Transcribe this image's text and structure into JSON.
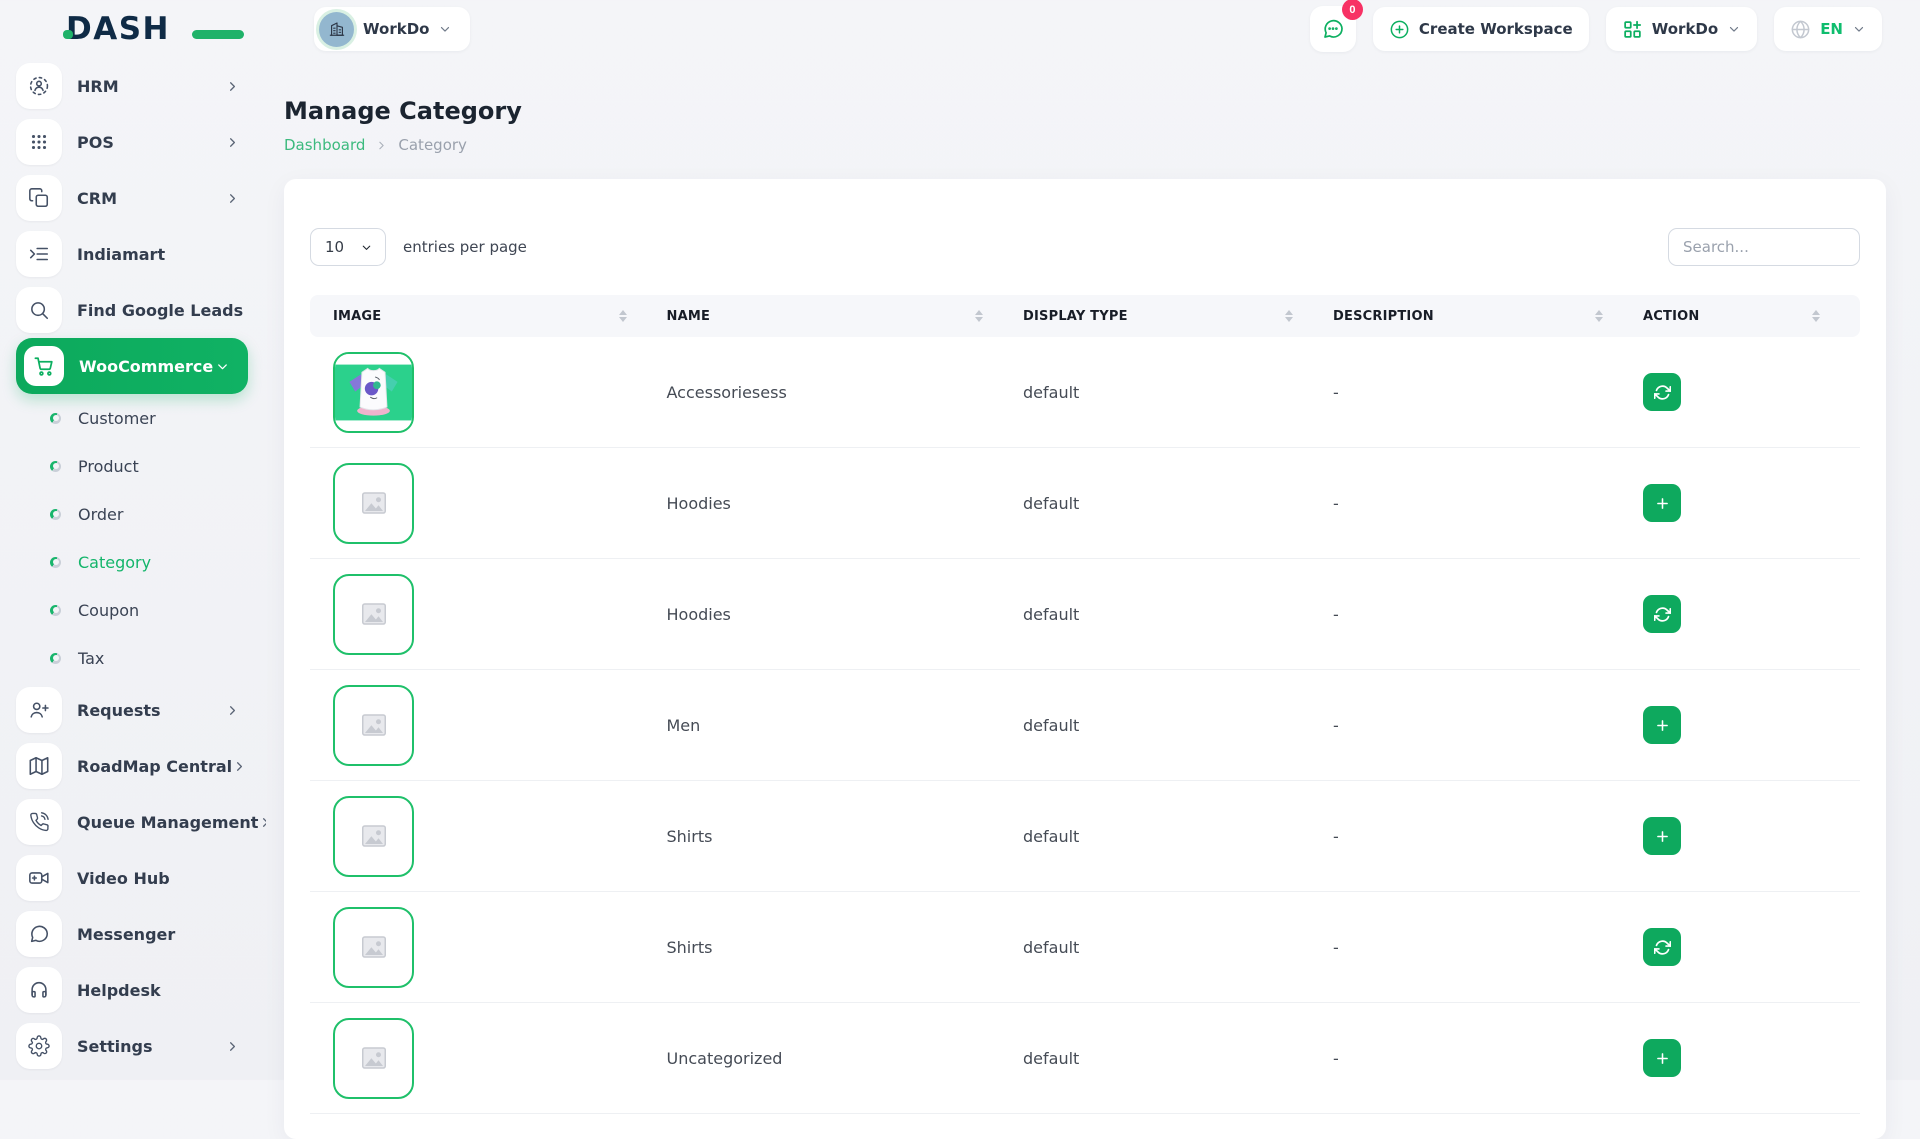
{
  "brand": {
    "logo_text": "DASH"
  },
  "header": {
    "workspace_label": "WorkDo",
    "chat_badge": "0",
    "create_workspace_label": "Create Workspace",
    "workdo_menu_label": "WorkDo",
    "language": "EN"
  },
  "sidebar": {
    "items_top": [
      {
        "label": "HRM",
        "icon": "hrm-icon",
        "chevron": true,
        "active": false
      },
      {
        "label": "POS",
        "icon": "pos-grid-icon",
        "chevron": true,
        "active": false
      },
      {
        "label": "CRM",
        "icon": "crm-icon",
        "chevron": true,
        "active": false
      },
      {
        "label": "Indiamart",
        "icon": "indiamart-icon",
        "chevron": false,
        "active": false
      },
      {
        "label": "Find Google Leads",
        "icon": "search-icon",
        "chevron": false,
        "active": false
      },
      {
        "label": "WooCommerce",
        "icon": "cart-icon",
        "chevron": "down",
        "active": true
      }
    ],
    "woocommerce_children": [
      {
        "label": "Customer",
        "active": false
      },
      {
        "label": "Product",
        "active": false
      },
      {
        "label": "Order",
        "active": false
      },
      {
        "label": "Category",
        "active": true
      },
      {
        "label": "Coupon",
        "active": false
      },
      {
        "label": "Tax",
        "active": false
      }
    ],
    "items_bottom": [
      {
        "label": "Requests",
        "icon": "user-plus-icon",
        "chevron": true
      },
      {
        "label": "RoadMap Central",
        "icon": "map-icon",
        "chevron": true
      },
      {
        "label": "Queue Management",
        "icon": "phone-call-icon",
        "chevron": true
      },
      {
        "label": "Video Hub",
        "icon": "video-icon",
        "chevron": false
      },
      {
        "label": "Messenger",
        "icon": "chat-bubble-icon",
        "chevron": false
      },
      {
        "label": "Helpdesk",
        "icon": "headset-icon",
        "chevron": false
      },
      {
        "label": "Settings",
        "icon": "gear-icon",
        "chevron": true
      }
    ]
  },
  "page": {
    "title": "Manage Category",
    "breadcrumb": [
      {
        "label": "Dashboard"
      },
      {
        "label": "Category"
      }
    ]
  },
  "table_controls": {
    "page_size": "10",
    "entries_label": "entries per page",
    "search_placeholder": "Search..."
  },
  "table": {
    "columns": [
      "IMAGE",
      "NAME",
      "DISPLAY TYPE",
      "DESCRIPTION",
      "ACTION"
    ],
    "rows": [
      {
        "name": "Accessoriesess",
        "display_type": "default",
        "description": "-",
        "action": "refresh",
        "image": "tshirt-photo"
      },
      {
        "name": "Hoodies",
        "display_type": "default",
        "description": "-",
        "action": "plus",
        "image": "placeholder"
      },
      {
        "name": "Hoodies",
        "display_type": "default",
        "description": "-",
        "action": "refresh",
        "image": "placeholder"
      },
      {
        "name": "Men",
        "display_type": "default",
        "description": "-",
        "action": "plus",
        "image": "placeholder"
      },
      {
        "name": "Shirts",
        "display_type": "default",
        "description": "-",
        "action": "plus",
        "image": "placeholder"
      },
      {
        "name": "Shirts",
        "display_type": "default",
        "description": "-",
        "action": "refresh",
        "image": "placeholder"
      },
      {
        "name": "Uncategorized",
        "display_type": "default",
        "description": "-",
        "action": "plus",
        "image": "placeholder"
      }
    ]
  },
  "colors": {
    "primary_green": "#0caf60",
    "active_link_green": "#3cba7e",
    "badge_pink": "#f73164",
    "logo_navy": "#0f2b46",
    "table_header_bg": "#f6f7fa"
  }
}
